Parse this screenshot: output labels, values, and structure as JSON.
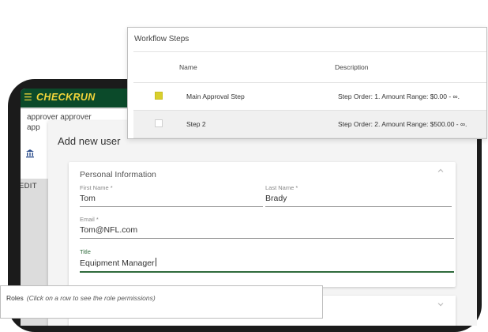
{
  "app": {
    "brand": "CHECKRUN",
    "hamburger_icon": "menu-icon",
    "accent_color": "#0b4a2a",
    "brand_color": "#f3d53a"
  },
  "background": {
    "line1": "approver approver",
    "line2": "app",
    "bank_icon": "bank-icon",
    "edit_label": "EDIT"
  },
  "dialog": {
    "title": "Add new user",
    "personal_info": {
      "title": "Personal Information",
      "first_name": {
        "label": "First Name *",
        "value": "Tom"
      },
      "last_name": {
        "label": "Last Name *",
        "value": "Brady"
      },
      "email": {
        "label": "Email *",
        "value": "Tom@NFL.com"
      },
      "title_field": {
        "label": "Title",
        "value": "Equipment Manager"
      }
    }
  },
  "workflow": {
    "title": "Workflow Steps",
    "columns": [
      "Name",
      "Description"
    ],
    "rows": [
      {
        "checked": true,
        "name": "Main Approval Step",
        "description": "Step Order: 1. Amount Range: $0.00 - ∞."
      },
      {
        "checked": false,
        "name": "Step 2",
        "description": "Step Order: 2. Amount Range: $500.00 - ∞."
      }
    ],
    "checkbox_color": "#d9cf2c"
  },
  "roles": {
    "title": "Roles",
    "hint": "(Click on a row to see the role permissions)"
  }
}
